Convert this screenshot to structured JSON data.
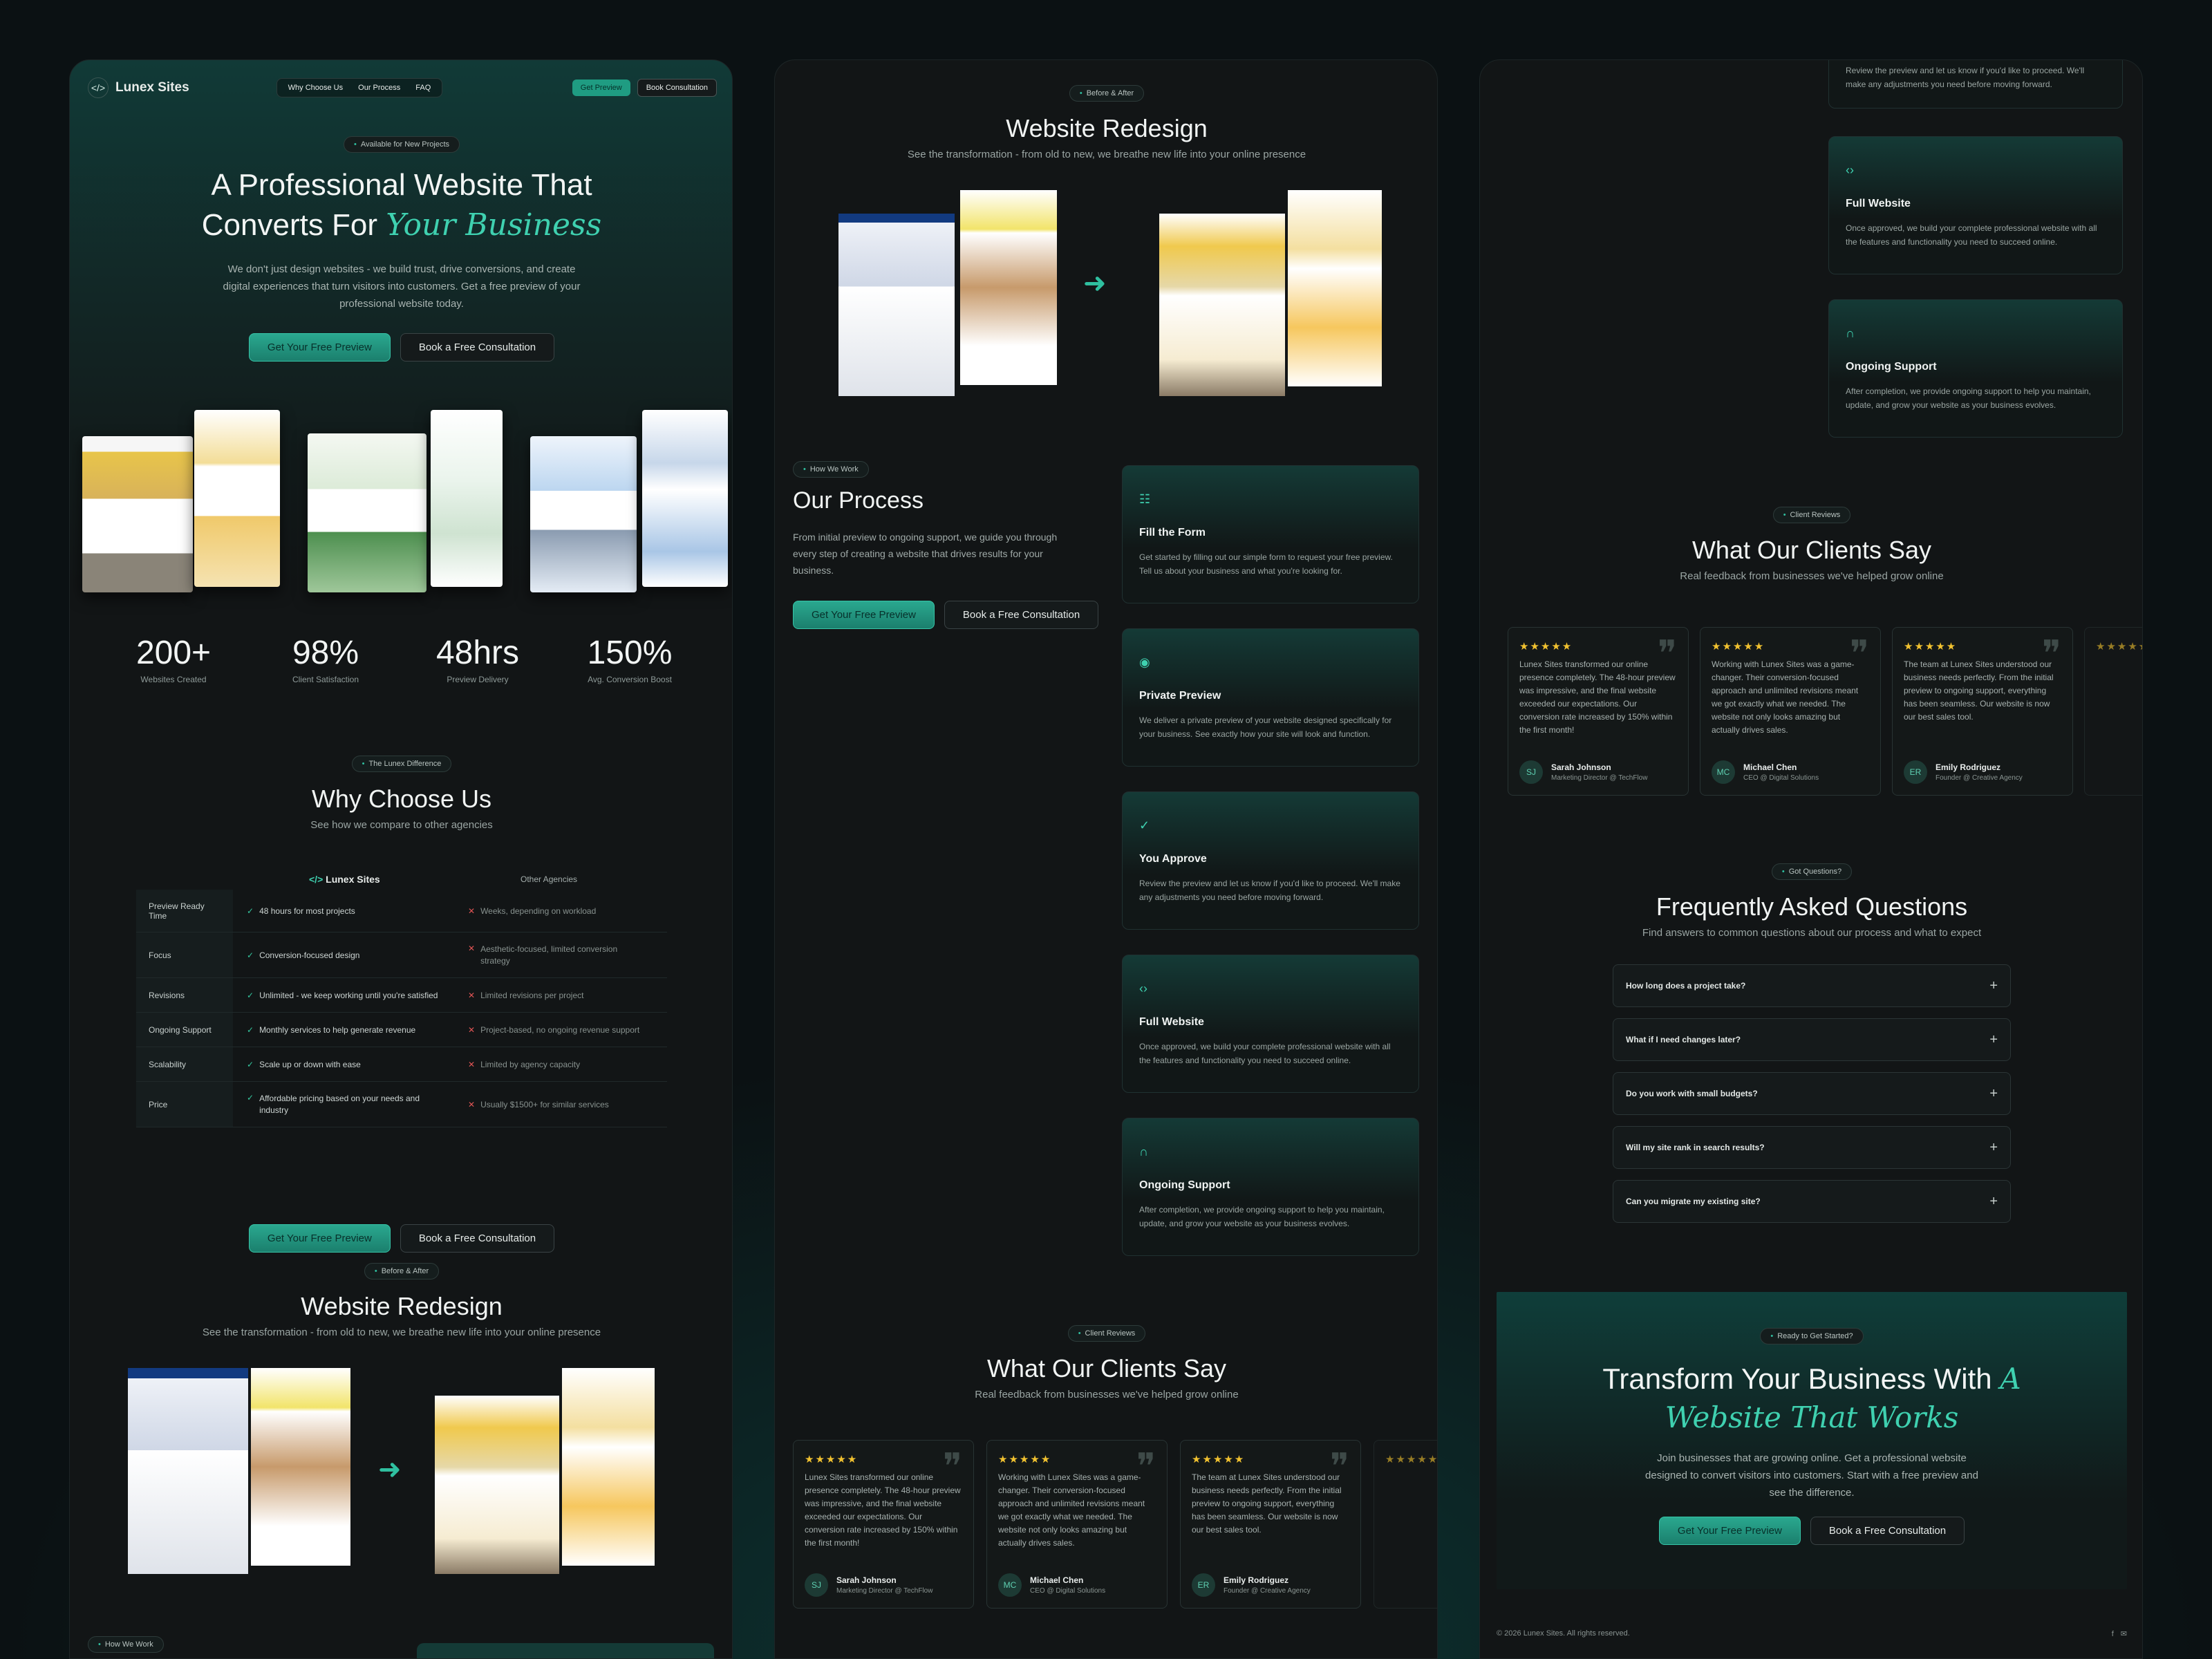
{
  "brand": {
    "name": "Lunex Sites",
    "logo_icon": "code-icon"
  },
  "nav": {
    "items": [
      "Why Choose Us",
      "Our Process",
      "FAQ"
    ],
    "get_preview": "Get Preview",
    "book": "Book Consultation"
  },
  "hero": {
    "badge": "Available for New Projects",
    "title_line1": "A Professional Website That",
    "title_line2": "Converts For ",
    "title_accent": "Your Business",
    "desc": "We don't just design websites - we build trust, drive conversions, and create digital experiences that turn visitors into customers. Get a free preview of your professional website today.",
    "cta_primary": "Get Your Free Preview",
    "cta_secondary": "Book a Free Consultation"
  },
  "stats": [
    {
      "n": "200+",
      "l": "Websites Created"
    },
    {
      "n": "98%",
      "l": "Client Satisfaction"
    },
    {
      "n": "48hrs",
      "l": "Preview Delivery"
    },
    {
      "n": "150%",
      "l": "Avg. Conversion Boost"
    }
  ],
  "why": {
    "badge": "The Lunex Difference",
    "title": "Why Choose Us",
    "sub": "See how we compare to other agencies",
    "col_us": "Lunex Sites",
    "col_them": "Other Agencies",
    "rows": [
      {
        "k": "Preview Ready Time",
        "a": "48 hours for most projects",
        "b": "Weeks, depending on workload"
      },
      {
        "k": "Focus",
        "a": "Conversion-focused design",
        "b": "Aesthetic-focused, limited conversion strategy"
      },
      {
        "k": "Revisions",
        "a": "Unlimited - we keep working until you're satisfied",
        "b": "Limited revisions per project"
      },
      {
        "k": "Ongoing Support",
        "a": "Monthly services to help generate revenue",
        "b": "Project-based, no ongoing revenue support"
      },
      {
        "k": "Scalability",
        "a": "Scale up or down with ease",
        "b": "Limited by agency capacity"
      },
      {
        "k": "Price",
        "a": "Affordable pricing based on your needs and industry",
        "b": "Usually $1500+ for similar services"
      }
    ]
  },
  "redesign": {
    "badge": "Before & After",
    "title": "Website Redesign",
    "sub": "See the transformation - from old to new, we breathe new life into your online presence"
  },
  "process": {
    "badge": "How We Work",
    "title": "Our Process",
    "desc": "From initial preview to ongoing support, we guide you through every step of creating a website that drives results for your business.",
    "steps": [
      {
        "icon": "document-icon",
        "glyph": "☷",
        "t": "Fill the Form",
        "d": "Get started by filling out our simple form to request your free preview. Tell us about your business and what you're looking for."
      },
      {
        "icon": "eye-icon",
        "glyph": "◉",
        "t": "Private Preview",
        "d": "We deliver a private preview of your website designed specifically for your business. See exactly how your site will look and function."
      },
      {
        "icon": "check-circle-icon",
        "glyph": "✓",
        "t": "You Approve",
        "d": "Review the preview and let us know if you'd like to proceed. We'll make any adjustments you need before moving forward."
      },
      {
        "icon": "code-icon",
        "glyph": "‹›",
        "t": "Full Website",
        "d": "Once approved, we build your complete professional website with all the features and functionality you need to succeed online."
      },
      {
        "icon": "headphones-icon",
        "glyph": "∩",
        "t": "Ongoing Support",
        "d": "After completion, we provide ongoing support to help you maintain, update, and grow your website as your business evolves."
      }
    ]
  },
  "reviews": {
    "badge": "Client Reviews",
    "title": "What Our Clients Say",
    "sub": "Real feedback from businesses we've helped grow online",
    "items": [
      {
        "stars": "★★★★★",
        "text": "Lunex Sites transformed our online presence completely. The 48-hour preview was impressive, and the final website exceeded our expectations. Our conversion rate increased by 150% within the first month!",
        "initials": "SJ",
        "name": "Sarah Johnson",
        "role": "Marketing Director @ TechFlow"
      },
      {
        "stars": "★★★★★",
        "text": "Working with Lunex Sites was a game-changer. Their conversion-focused approach and unlimited revisions meant we got exactly what we needed. The website not only looks amazing but actually drives sales.",
        "initials": "MC",
        "name": "Michael Chen",
        "role": "CEO @ Digital Solutions"
      },
      {
        "stars": "★★★★★",
        "text": "The team at Lunex Sites understood our business needs perfectly. From the initial preview to ongoing support, everything has been seamless. Our website is now our best sales tool.",
        "initials": "ER",
        "name": "Emily Rodriguez",
        "role": "Founder @ Creative Agency"
      }
    ]
  },
  "faq": {
    "badge": "Got Questions?",
    "title": "Frequently Asked Questions",
    "sub": "Find answers to common questions about our process and what to expect",
    "items": [
      "How long does a project take?",
      "What if I need changes later?",
      "Do you work with small budgets?",
      "Will my site rank in search results?",
      "Can you migrate my existing site?"
    ]
  },
  "cta": {
    "badge": "Ready to Get Started?",
    "title1": "Transform Your Business With ",
    "accent1": "A",
    "accent2": "Website That Works",
    "desc": "Join businesses that are growing online. Get a professional website designed to convert visitors into customers. Start with a free preview and see the difference."
  },
  "footer": {
    "copy": "© 2026 Lunex Sites. All rights reserved."
  },
  "colors": {
    "accent": "#2fc0a0",
    "star": "#f2c230"
  }
}
